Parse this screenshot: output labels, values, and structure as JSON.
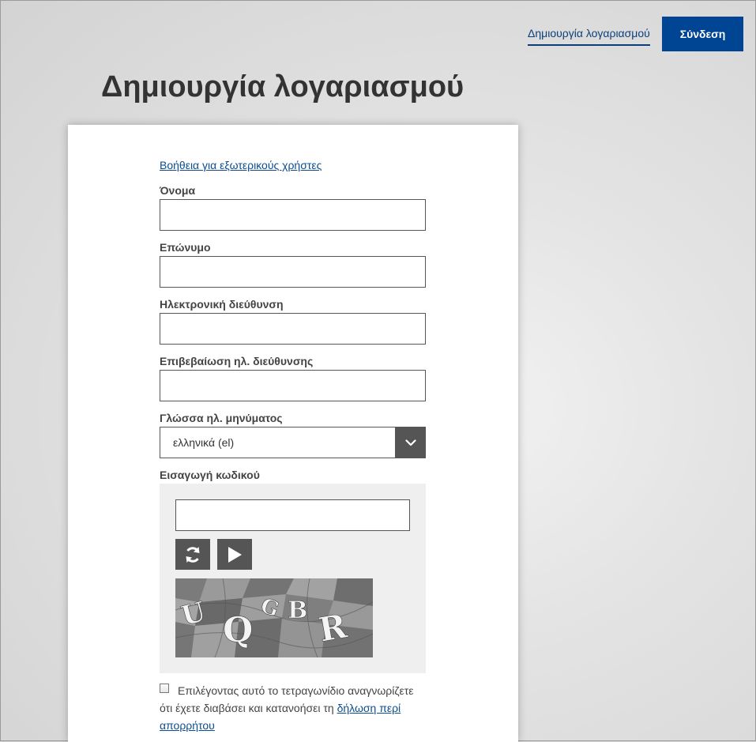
{
  "header": {
    "create_account_link": "Δημιουργία λογαριασμού",
    "login_button": "Σύνδεση"
  },
  "page_title": "Δημιουργία λογαριασμού",
  "form": {
    "help_link": "Βοήθεια για εξωτερικούς χρήστες",
    "first_name": {
      "label": "Όνομα",
      "value": ""
    },
    "last_name": {
      "label": "Επώνυμο",
      "value": ""
    },
    "email": {
      "label": "Ηλεκτρονική διεύθυνση",
      "value": ""
    },
    "email_confirm": {
      "label": "Επιβεβαίωση ηλ. διεύθυνσης",
      "value": ""
    },
    "email_language": {
      "label": "Γλώσσα ηλ. μηνύματος",
      "selected": "ελληνικά (el)"
    },
    "captcha": {
      "label": "Εισαγωγή κωδικού",
      "value": "",
      "refresh_icon": "refresh-icon",
      "audio_icon": "play-icon",
      "chars": [
        "U",
        "Q",
        "G",
        "B",
        "R"
      ]
    },
    "consent": {
      "checked": false,
      "text": "Επιλέγοντας αυτό το τετραγωνίδιο αναγνωρίζετε ότι έχετε διαβάσει και κατανοήσει τη ",
      "link": "δήλωση περί απορρήτου"
    }
  },
  "colors": {
    "primary": "#004494",
    "link": "#0b4d8f",
    "dark_button": "#555555"
  }
}
